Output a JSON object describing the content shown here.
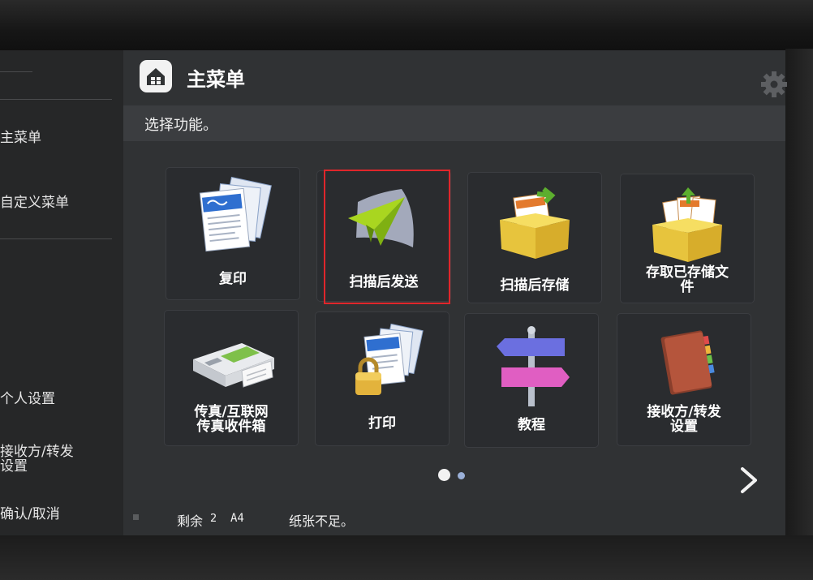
{
  "sidebar": {
    "items": [
      {
        "label": "主菜单"
      },
      {
        "label": "自定义菜单"
      },
      {
        "label": "个人设置"
      },
      {
        "label": "接收方/转发\n设置"
      },
      {
        "label": "确认/取消"
      }
    ]
  },
  "header": {
    "title": "主菜单",
    "home_icon": "home-icon",
    "settings_icon": "gear-icon"
  },
  "subheader": {
    "text": "选择功能。"
  },
  "tiles": [
    {
      "label": "复印",
      "icon": "copy-documents-icon"
    },
    {
      "label": "扫描后发送",
      "icon": "paper-plane-icon",
      "highlighted": true
    },
    {
      "label": "扫描后存储",
      "icon": "storage-box-icon"
    },
    {
      "label": "存取已存储文\n件",
      "icon": "stored-files-box-icon"
    },
    {
      "label": "传真/互联网\n传真收件箱",
      "icon": "fax-machine-icon"
    },
    {
      "label": "打印",
      "icon": "secure-print-icon"
    },
    {
      "label": "教程",
      "icon": "signpost-icon"
    },
    {
      "label": "接收方/转发\n设置",
      "icon": "address-book-icon"
    }
  ],
  "pagination": {
    "pages": 2,
    "current": 1
  },
  "status": {
    "remaining_label": "剩余",
    "remaining_count": "2",
    "paper_size": "A4",
    "message": "纸张不足。"
  },
  "colors": {
    "highlight_border": "#e0262b",
    "screen_bg": "#303234",
    "sidebar_bg": "#262728"
  }
}
